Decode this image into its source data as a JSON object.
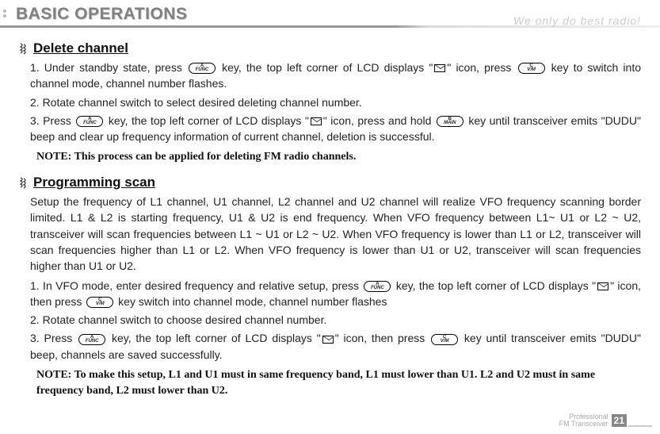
{
  "page_title": "BASIC OPERATIONS",
  "tagline": "We only do best radio!",
  "section1": {
    "heading": "Delete channel",
    "item1_a": "1. Under standby state, press ",
    "item1_b": " key, the top left corner of LCD displays \"",
    "item1_c": "\" icon, press ",
    "item1_d": " key to switch into channel mode, channel number flashes.",
    "item2": "2. Rotate channel switch to select desired deleting channel number.",
    "item3_a": "3. Press ",
    "item3_b": " key, the top left corner of LCD displays \"",
    "item3_c": "\" icon, press and hold ",
    "item3_d": " key until transceiver emits \"DUDU\" beep and clear up frequency information of current channel, deletion is successful.",
    "note": "NOTE: This process can be applied for deleting FM radio channels."
  },
  "section2": {
    "heading": "Programming scan",
    "setup": "Setup the frequency of L1 channel, U1 channel, L2 channel and U2 channel will realize VFO frequency scanning border limited. L1 & L2 is starting frequency, U1 & U2 is end frequency. When VFO frequency between L1~ U1 or L2 ~ U2, transceiver will scan frequencies between L1 ~ U1 or L2 ~ U2. When VFO frequency is lower than L1 or L2, transceiver will scan frequencies higher than L1 or L2. When VFO frequency is lower than U1 or U2, transceiver will scan frequencies higher than U1 or U2.",
    "item1_a": "1. In VFO mode, enter desired frequency and relative setup, press ",
    "item1_b": " key, the top left corner of LCD displays \"",
    "item1_c": "\"  icon, then press ",
    "item1_d": " key switch into channel mode, channel number flashes",
    "item2": "2. Rotate channel switch to choose desired channel number.",
    "item3_a": "3. Press ",
    "item3_b": " key, the top left corner of LCD displays \"",
    "item3_c": "\" icon, then press ",
    "item3_d": " key until transceiver emits \"DUDU\" beep, channels are saved successfully.",
    "note": "NOTE: To make this setup, L1 and U1 must in same frequency band, L1 must lower than U1. L2 and U2 must in same frequency band, L2 must lower than U2."
  },
  "keys": {
    "a_top": "A",
    "a_bot": "FUNC",
    "b_top": "B",
    "b_bot": "MAIN",
    "c_top": "C",
    "c_bot": "V/M"
  },
  "footer": {
    "line1": "Professional",
    "line2": "FM Transceiver",
    "page_num": "21"
  }
}
